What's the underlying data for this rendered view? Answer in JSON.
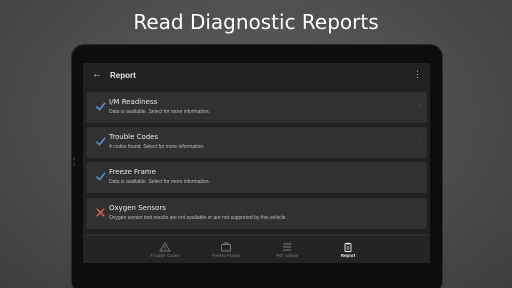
{
  "headline": "Read Diagnostic Reports",
  "appbar": {
    "back_icon": "arrow-back-icon",
    "title": "Report",
    "menu_icon": "more-vert-icon"
  },
  "cards": [
    {
      "name": "I/M Readiness",
      "desc": "Data is available. Select for more information.",
      "status": "ok"
    },
    {
      "name": "Trouble Codes",
      "desc": "4 codes found. Select for more information.",
      "status": "ok"
    },
    {
      "name": "Freeze Frame",
      "desc": "Data is available. Select for more information.",
      "status": "ok"
    },
    {
      "name": "Oxygen Sensors",
      "desc": "Oxygen sensor test results are not available or are not supported by this vehicle.",
      "status": "error"
    }
  ],
  "bottomnav": [
    {
      "label": "Trouble Codes",
      "icon": "warning-icon",
      "active": false
    },
    {
      "label": "Freeze Frame",
      "icon": "freeze-frame-icon",
      "active": false
    },
    {
      "label": "PID Values",
      "icon": "list-icon",
      "active": false
    },
    {
      "label": "Report",
      "icon": "clipboard-icon",
      "active": true
    }
  ],
  "colors": {
    "ok": "#5b9bd5",
    "error": "#d9654d",
    "background": "#505050",
    "screen": "#212121",
    "card": "#313131"
  }
}
